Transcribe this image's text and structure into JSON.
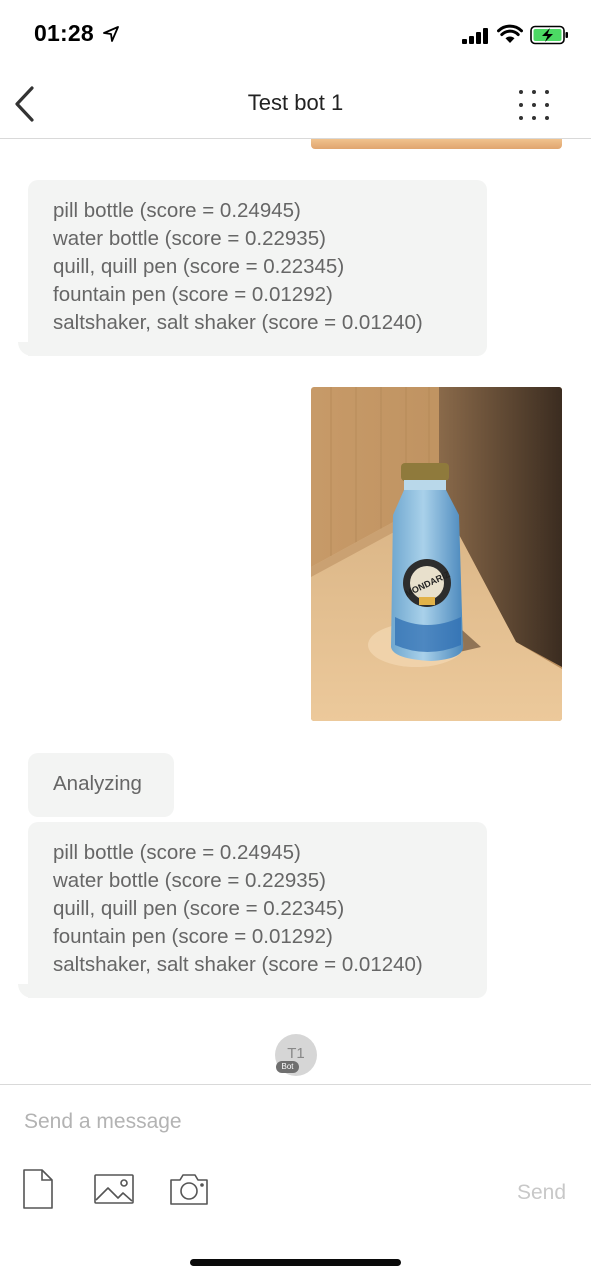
{
  "status_bar": {
    "time": "01:28",
    "location_icon": "location-arrow-icon",
    "signal_icon": "signal-bars-icon",
    "wifi_icon": "wifi-icon",
    "battery_icon": "battery-charging-icon",
    "battery_color": "#4cd964"
  },
  "nav": {
    "title": "Test bot 1",
    "back_icon": "chevron-left-icon",
    "menu_icon": "dots-grid-icon"
  },
  "messages": [
    {
      "type": "bot_text",
      "lines": [
        "pill bottle (score = 0.24945)",
        "water bottle (score = 0.22935)",
        "quill, quill pen (score = 0.22345)",
        "fountain pen (score = 0.01292)",
        "saltshaker, salt shaker (score = 0.01240)"
      ]
    },
    {
      "type": "user_image",
      "label": "MONDARIZ"
    },
    {
      "type": "bot_text",
      "lines": [
        "Analyzing"
      ]
    },
    {
      "type": "bot_text",
      "lines": [
        "pill bottle (score = 0.24945)",
        "water bottle (score = 0.22935)",
        "quill, quill pen (score = 0.22345)",
        "fountain pen (score = 0.01292)",
        "saltshaker, salt shaker (score = 0.01240)"
      ]
    }
  ],
  "bot_avatar": {
    "initials": "T1",
    "badge": "Bot"
  },
  "composer": {
    "placeholder": "Send a message",
    "send_label": "Send",
    "icons": [
      "file-icon",
      "image-icon",
      "camera-icon"
    ]
  },
  "colors": {
    "bubble_bg": "#f3f4f3",
    "bubble_text": "#666666",
    "send_disabled": "#c8c8c8"
  }
}
